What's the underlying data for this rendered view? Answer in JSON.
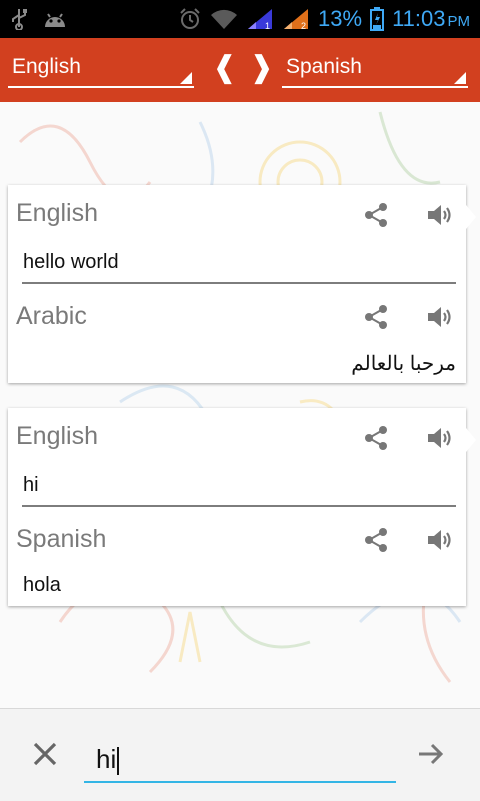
{
  "status_bar": {
    "battery_percent": "13%",
    "time": "11:03",
    "ampm": "PM",
    "icons": [
      "usb-icon",
      "android-icon",
      "alarm-icon",
      "wifi-icon",
      "signal-1-icon",
      "signal-2-icon",
      "battery-icon"
    ]
  },
  "lang_bar": {
    "source_language": "English",
    "target_language": "Spanish",
    "swap_left": "❰",
    "swap_right": "❱"
  },
  "cards": [
    {
      "source_label": "English",
      "source_text": "hello world",
      "target_label": "Arabic",
      "target_text": "مرحبا بالعالم"
    },
    {
      "source_label": "English",
      "source_text": "hi",
      "target_label": "Spanish",
      "target_text": "hola"
    }
  ],
  "input": {
    "value": "hi"
  },
  "colors": {
    "accent": "#d2401f",
    "input_underline": "#33b5e5",
    "status_icons": "#3fa9f5"
  }
}
